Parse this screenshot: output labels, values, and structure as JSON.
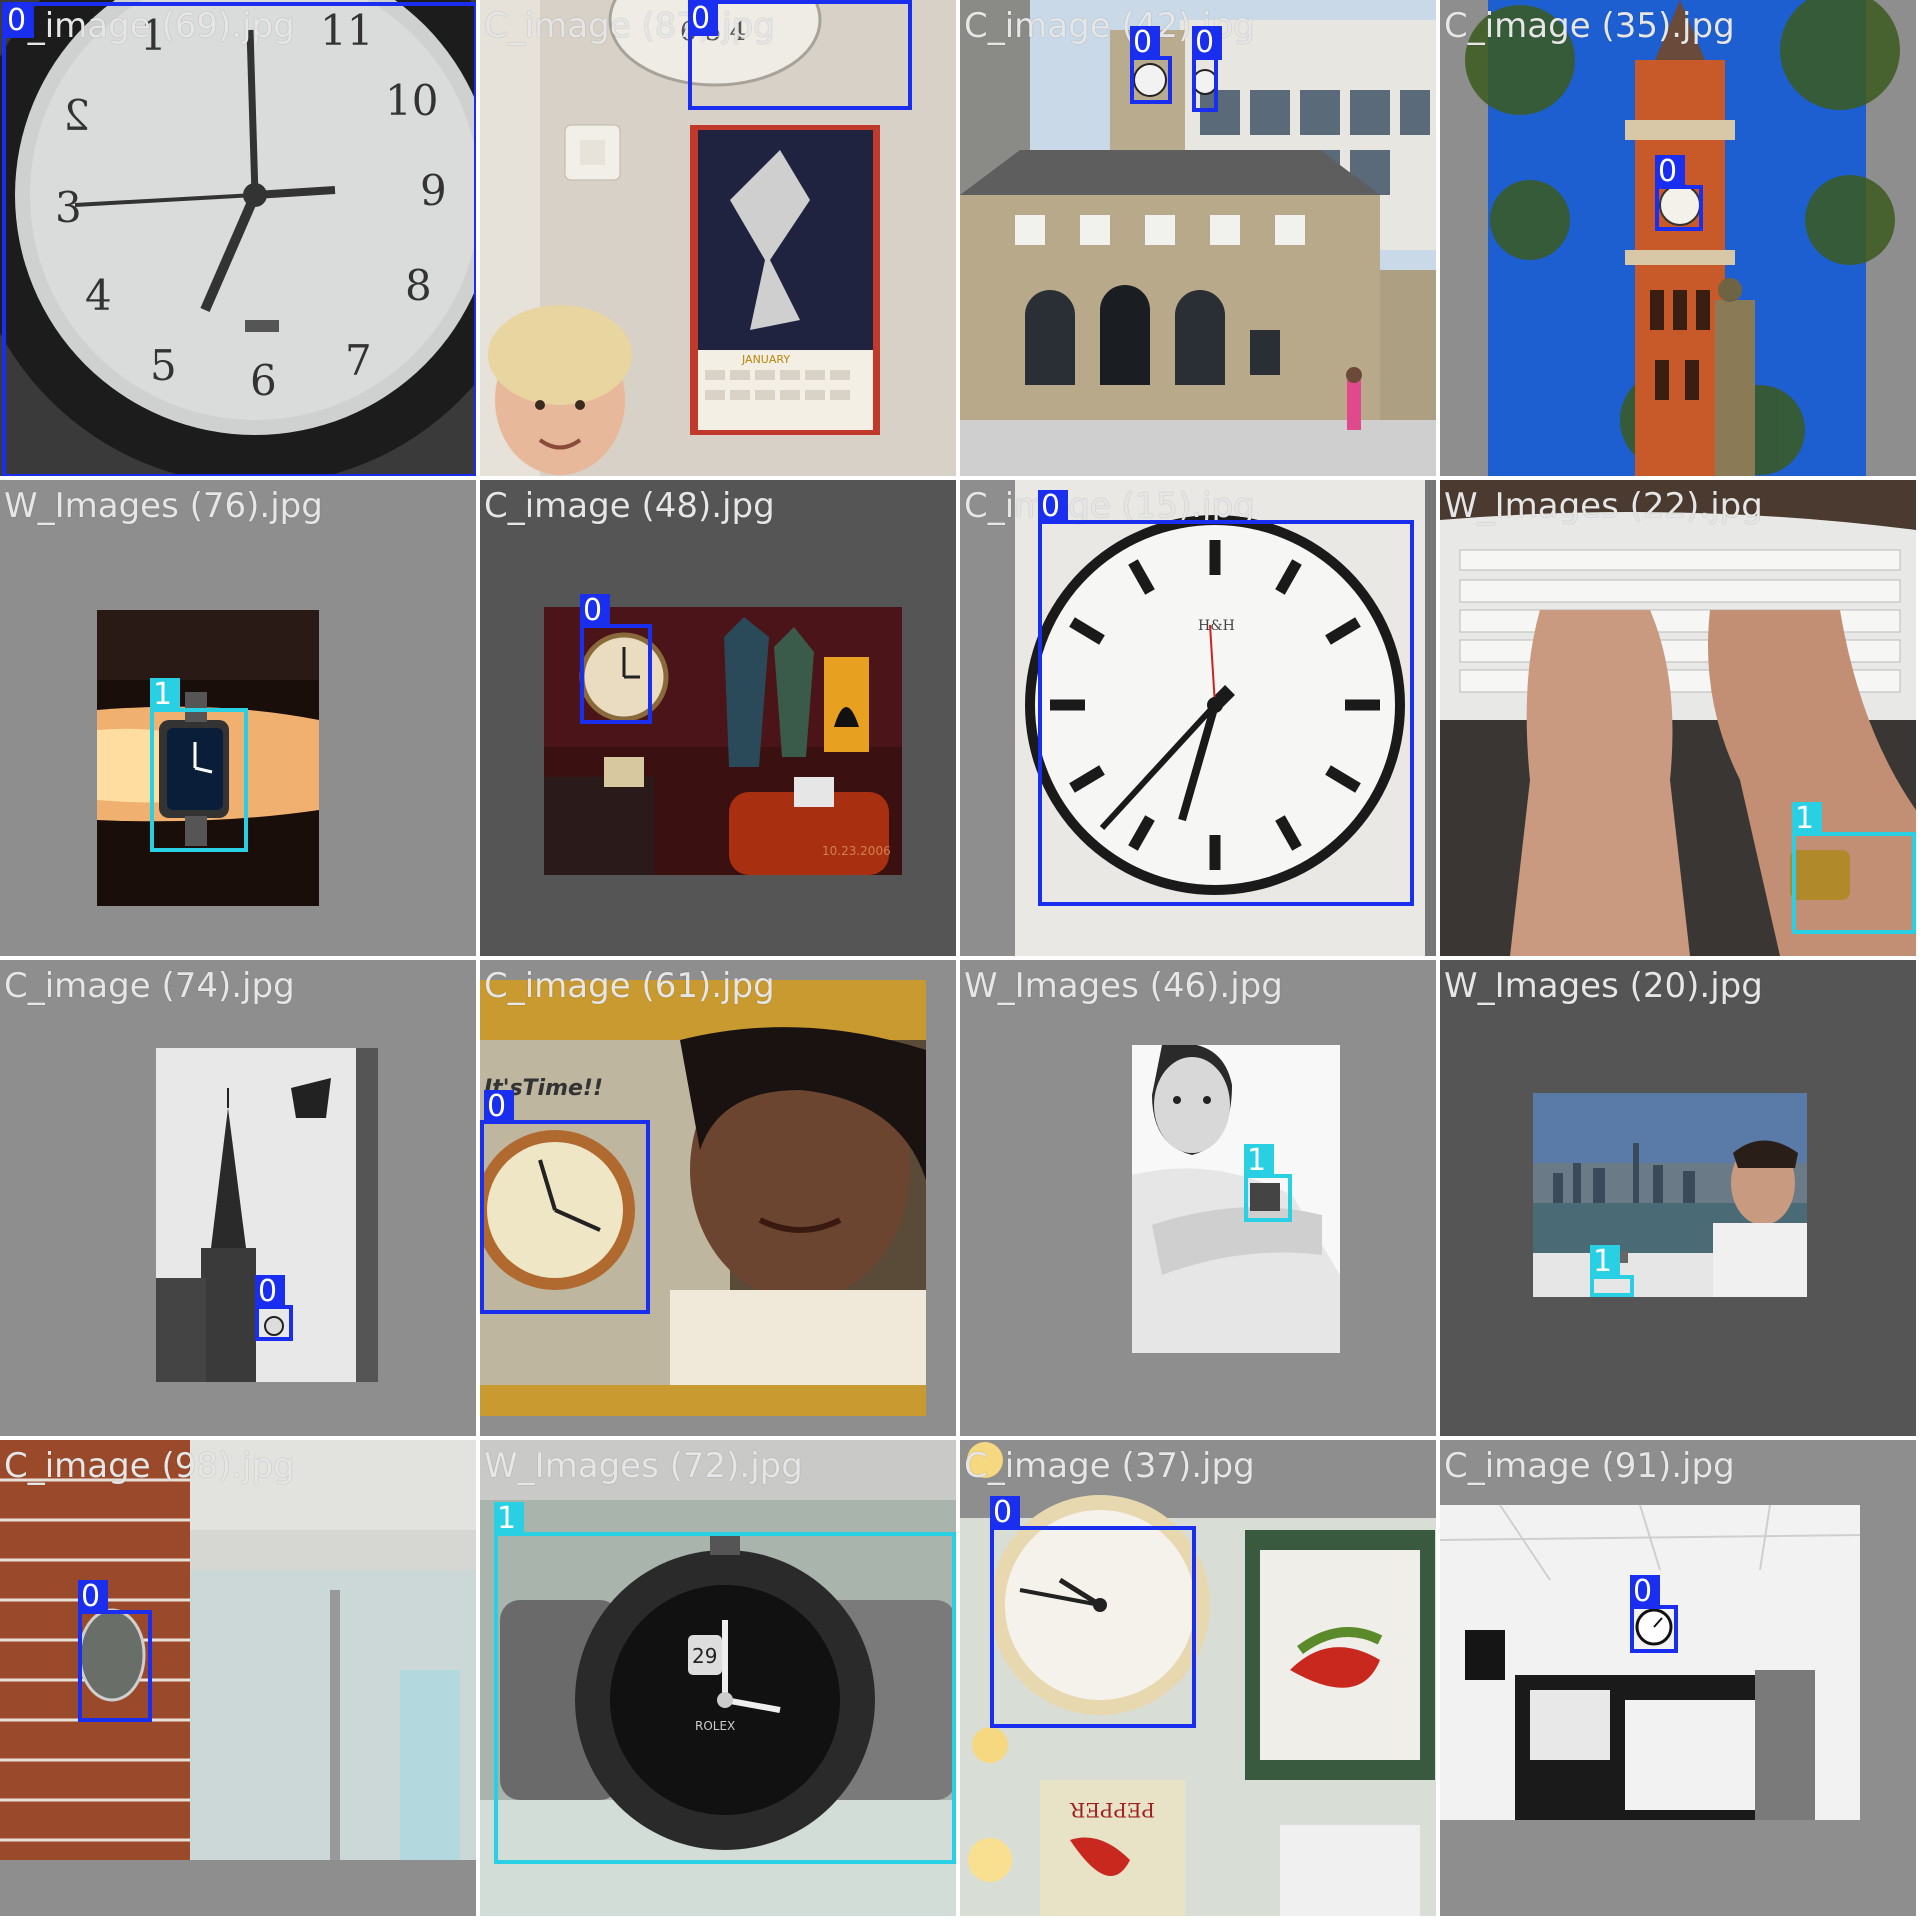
{
  "colors": {
    "class0": "#1a2ef0",
    "class1": "#29cfe3",
    "tile_light_bg": "#8e8e8e",
    "tile_dark_bg": "#555555"
  },
  "tiles": [
    {
      "filename": "C_image (69).jpg",
      "boxes": [
        {
          "label": "0"
        }
      ]
    },
    {
      "filename": "C_image (87).jpg",
      "boxes": [
        {
          "label": "0"
        }
      ]
    },
    {
      "filename": "C_image (42).jpg",
      "boxes": [
        {
          "label": "0"
        },
        {
          "label": "0"
        }
      ]
    },
    {
      "filename": "C_image (35).jpg",
      "boxes": [
        {
          "label": "0"
        }
      ]
    },
    {
      "filename": "W_Images (76).jpg",
      "boxes": [
        {
          "label": "1"
        }
      ]
    },
    {
      "filename": "C_image (48).jpg",
      "boxes": [
        {
          "label": "0"
        }
      ]
    },
    {
      "filename": "C_image (15).jpg",
      "boxes": [
        {
          "label": "0"
        }
      ]
    },
    {
      "filename": "W_Images (22).jpg",
      "boxes": [
        {
          "label": "1"
        }
      ]
    },
    {
      "filename": "C_image (74).jpg",
      "boxes": [
        {
          "label": "0"
        }
      ]
    },
    {
      "filename": "C_image (61).jpg",
      "boxes": [
        {
          "label": "0"
        }
      ]
    },
    {
      "filename": "W_Images (46).jpg",
      "boxes": [
        {
          "label": "1"
        }
      ]
    },
    {
      "filename": "W_Images (20).jpg",
      "boxes": [
        {
          "label": "1"
        }
      ]
    },
    {
      "filename": "C_image (98).jpg",
      "boxes": [
        {
          "label": "0"
        }
      ]
    },
    {
      "filename": "W_Images (72).jpg",
      "boxes": [
        {
          "label": "1"
        }
      ]
    },
    {
      "filename": "C_image (37).jpg",
      "boxes": [
        {
          "label": "0"
        }
      ]
    },
    {
      "filename": "C_image (91).jpg",
      "boxes": [
        {
          "label": "0"
        }
      ]
    }
  ],
  "photo_text": {
    "calendar_month": "JANUARY",
    "clock_brand": "H&H",
    "its_time": "It'sTime!!",
    "date_stamp": "10.23.2006",
    "seed_packet": "PEPPER",
    "watch_date": "29",
    "watch_brand": "ROLEX"
  }
}
